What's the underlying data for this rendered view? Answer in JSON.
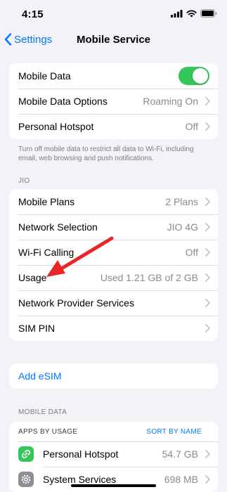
{
  "status_bar": {
    "time": "4:15"
  },
  "nav": {
    "back_label": "Settings",
    "title": "Mobile Service"
  },
  "group1": {
    "mobile_data": {
      "label": "Mobile Data",
      "toggle_on": true
    },
    "mobile_data_options": {
      "label": "Mobile Data Options",
      "value": "Roaming On"
    },
    "personal_hotspot": {
      "label": "Personal Hotspot",
      "value": "Off"
    }
  },
  "group1_footnote": "Turn off mobile data to restrict all data to Wi-Fi, including email, web browsing and push notifications.",
  "carrier_section": {
    "header": "JIO",
    "rows": [
      {
        "label": "Mobile Plans",
        "value": "2 Plans"
      },
      {
        "label": "Network Selection",
        "value": "JIO 4G"
      },
      {
        "label": "Wi-Fi Calling",
        "value": "Off"
      },
      {
        "label": "Usage",
        "value": "Used 1.21 GB of 2 GB"
      },
      {
        "label": "Network Provider Services",
        "value": ""
      },
      {
        "label": "SIM PIN",
        "value": ""
      }
    ]
  },
  "esim": {
    "label": "Add eSIM"
  },
  "mobile_data_section": {
    "header": "MOBILE DATA",
    "apps_by_usage": "APPS BY USAGE",
    "sort_by": "SORT BY NAME",
    "apps": [
      {
        "name": "Personal Hotspot",
        "usage": "54.7 GB",
        "icon": "hotspot-link-icon",
        "color": "#34c759"
      },
      {
        "name": "System Services",
        "usage": "698 MB",
        "icon": "gear-icon",
        "color": "#8e8e93"
      }
    ]
  },
  "colors": {
    "accent": "#007aff",
    "toggle_on": "#34c759",
    "annotation_arrow": "#e8262a"
  }
}
